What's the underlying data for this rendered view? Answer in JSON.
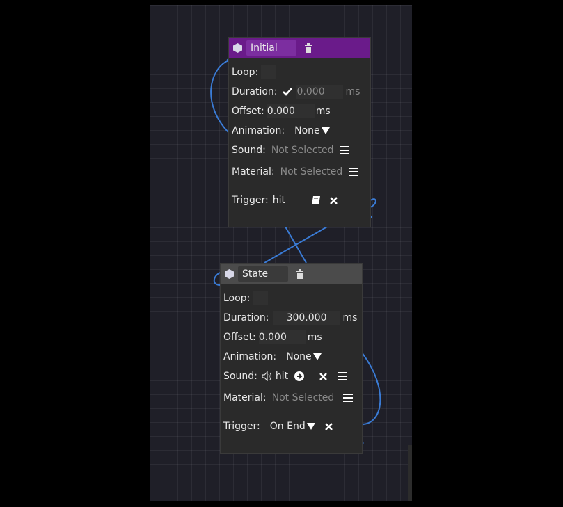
{
  "nodes": {
    "initial": {
      "name": "Initial",
      "loop_label": "Loop:",
      "duration_label": "Duration:",
      "duration_value": "0.000",
      "duration_unit": "ms",
      "offset_label": "Offset:",
      "offset_value": "0.000",
      "offset_unit": "ms",
      "animation_label": "Animation:",
      "animation_value": "None",
      "sound_label": "Sound:",
      "sound_value": "Not Selected",
      "material_label": "Material:",
      "material_value": "Not Selected",
      "trigger_label": "Trigger:",
      "trigger_value": "hit"
    },
    "state": {
      "name": "State",
      "loop_label": "Loop:",
      "duration_label": "Duration:",
      "duration_value": "300.000",
      "duration_unit": "ms",
      "offset_label": "Offset:",
      "offset_value": "0.000",
      "offset_unit": "ms",
      "animation_label": "Animation:",
      "animation_value": "None",
      "sound_label": "Sound:",
      "sound_value": "hit",
      "material_label": "Material:",
      "material_value": "Not Selected",
      "trigger_label": "Trigger:",
      "trigger_value": "On End"
    }
  },
  "icons": [
    "hexagon-icon",
    "trash-icon",
    "checkmark-icon",
    "dropdown-arrow-icon",
    "menu-icon",
    "book-icon",
    "close-icon",
    "speaker-icon",
    "arrow-right-circle-icon"
  ],
  "colors": {
    "initial_header": "#6a1b8a",
    "state_header": "#4b4b4b",
    "wire": "#3a7bd5",
    "canvas": "#1f1f28"
  }
}
